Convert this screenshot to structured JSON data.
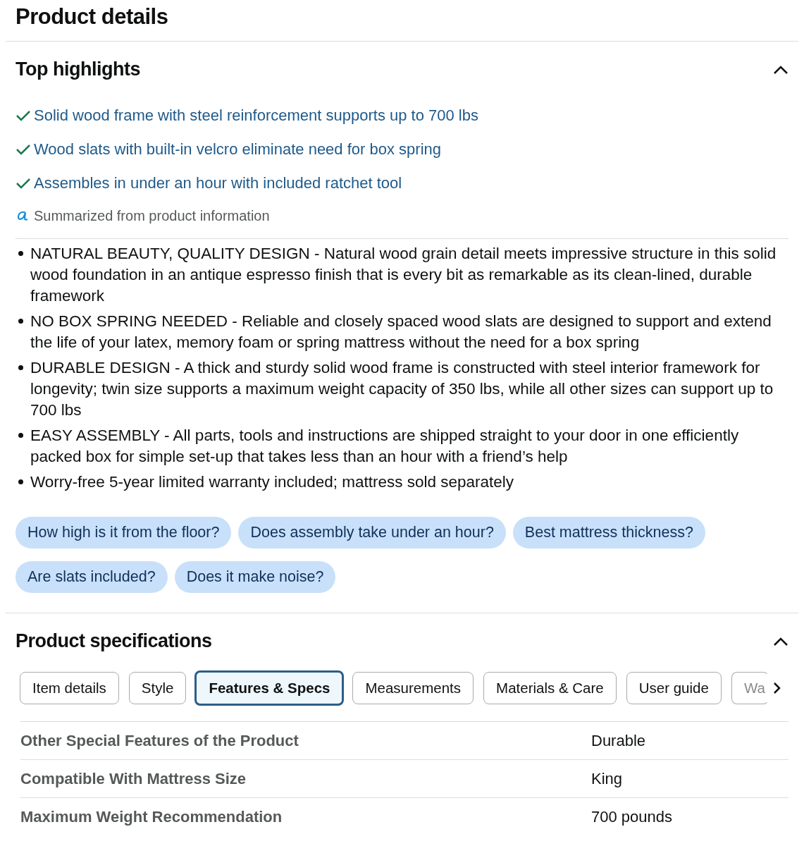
{
  "title": "Product details",
  "highlights_section": {
    "heading": "Top highlights",
    "expanded": true,
    "highlights": [
      "Solid wood frame with steel reinforcement supports up to 700 lbs",
      "Wood slats with built-in velcro eliminate need for box spring",
      "Assembles in under an hour with included ratchet tool"
    ],
    "summary_note": "Summarized from product information",
    "bullets": [
      "NATURAL BEAUTY, QUALITY DESIGN - Natural wood grain detail meets impressive structure in this solid wood foundation in an antique espresso finish that is every bit as remarkable as its clean-lined, durable framework",
      "NO BOX SPRING NEEDED - Reliable and closely spaced wood slats are designed to support and extend the life of your latex, memory foam or spring mattress without the need for a box spring",
      "DURABLE DESIGN - A thick and sturdy solid wood frame is constructed with steel interior framework for longevity; twin size supports a maximum weight capacity of 350 lbs, while all other sizes can support up to 700 lbs",
      "EASY ASSEMBLY - All parts, tools and instructions are shipped straight to your door in one efficiently packed box for simple set-up that takes less than an hour with a friend’s help",
      "Worry-free 5-year limited warranty included; mattress sold separately"
    ],
    "questions": [
      "How high is it from the floor?",
      "Does assembly take under an hour?",
      "Best mattress thickness?",
      "Are slats included?",
      "Does it make noise?"
    ]
  },
  "specs_section": {
    "heading": "Product specifications",
    "expanded": true,
    "tabs": [
      {
        "label": "Item details",
        "selected": false
      },
      {
        "label": "Style",
        "selected": false
      },
      {
        "label": "Features & Specs",
        "selected": true
      },
      {
        "label": "Measurements",
        "selected": false
      },
      {
        "label": "Materials & Care",
        "selected": false
      },
      {
        "label": "User guide",
        "selected": false
      },
      {
        "label": "Wa",
        "selected": false
      }
    ],
    "rows": [
      {
        "name": "Other Special Features of the Product",
        "value": "Durable"
      },
      {
        "name": "Compatible With Mattress Size",
        "value": "King"
      },
      {
        "name": "Maximum Weight Recommendation",
        "value": "700 pounds"
      }
    ]
  }
}
